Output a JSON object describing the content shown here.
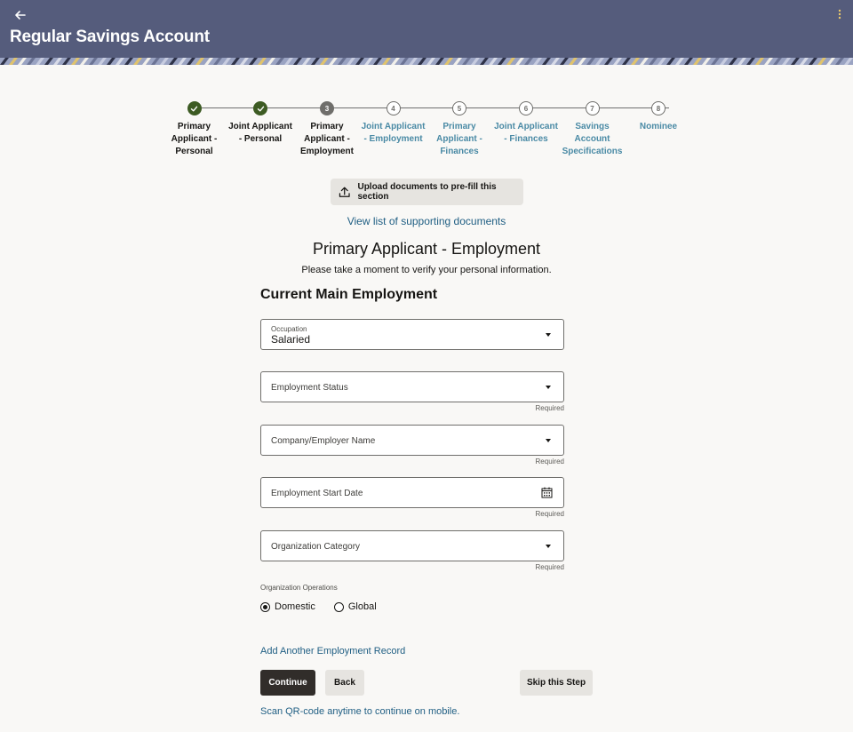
{
  "header": {
    "title": "Regular Savings Account",
    "back_icon": "back-arrow-icon",
    "menu_icon": "kebab-menu-icon",
    "background": "#555c7c"
  },
  "stepper": {
    "steps": [
      {
        "number": "1",
        "label": "Primary Applicant - Personal",
        "state": "completed"
      },
      {
        "number": "2",
        "label": "Joint Applicant - Personal",
        "state": "completed"
      },
      {
        "number": "3",
        "label": "Primary Applicant - Employment",
        "state": "current"
      },
      {
        "number": "4",
        "label": "Joint Applicant - Employment",
        "state": "upcoming"
      },
      {
        "number": "5",
        "label": "Primary Applicant - Finances",
        "state": "upcoming"
      },
      {
        "number": "6",
        "label": "Joint Applicant - Finances",
        "state": "upcoming"
      },
      {
        "number": "7",
        "label": "Savings Account Specifications",
        "state": "upcoming"
      },
      {
        "number": "8",
        "label": "Nominee",
        "state": "upcoming"
      }
    ],
    "completed_color": "#3d5b23",
    "upcoming_label_color": "#4a8aa5"
  },
  "upload": {
    "label": "Upload documents to pre-fill this section",
    "icon": "upload-icon"
  },
  "docs_link": "View list of supporting documents",
  "page_title": "Primary Applicant - Employment",
  "page_subtitle": "Please take a moment to verify your personal information.",
  "section_title": "Current Main Employment",
  "form": {
    "occupation": {
      "label": "Occupation",
      "value": "Salaried"
    },
    "employment_status": {
      "label": "Employment Status",
      "hint": "Required"
    },
    "employer_name": {
      "label": "Company/Employer Name",
      "hint": "Required"
    },
    "start_date": {
      "label": "Employment Start Date",
      "hint": "Required",
      "icon": "calendar-icon"
    },
    "org_category": {
      "label": "Organization Category",
      "hint": "Required"
    },
    "org_operations": {
      "label": "Organization Operations",
      "options": [
        "Domestic",
        "Global"
      ],
      "selected": "Domestic"
    }
  },
  "add_record_link": "Add Another Employment Record",
  "buttons": {
    "continue": "Continue",
    "back": "Back",
    "skip": "Skip this Step"
  },
  "qr_link": "Scan QR-code anytime to continue on mobile."
}
